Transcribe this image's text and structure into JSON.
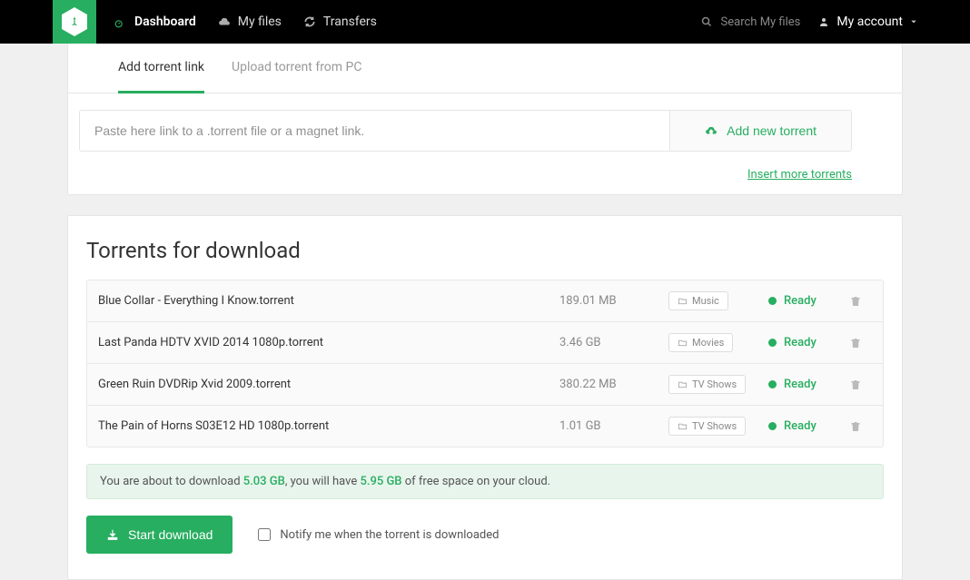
{
  "nav": {
    "dashboard": "Dashboard",
    "myfiles": "My files",
    "transfers": "Transfers",
    "search_placeholder": "Search My files",
    "account": "My account"
  },
  "tabs": {
    "add_link": "Add torrent link",
    "upload_pc": "Upload torrent from PC"
  },
  "add": {
    "placeholder": "Paste here link to a .torrent file or a magnet link.",
    "button": "Add new torrent",
    "insert_more": "Insert more torrents"
  },
  "section_title": "Torrents for download",
  "torrents": [
    {
      "name": "Blue Collar - Everything I Know.torrent",
      "size": "189.01 MB",
      "category": "Music",
      "status": "Ready"
    },
    {
      "name": "Last Panda HDTV XVID 2014 1080p.torrent",
      "size": "3.46 GB",
      "category": "Movies",
      "status": "Ready"
    },
    {
      "name": "Green Ruin DVDRip Xvid 2009.torrent",
      "size": "380.22 MB",
      "category": "TV Shows",
      "status": "Ready"
    },
    {
      "name": "The Pain of Horns S03E12 HD 1080p.torrent",
      "size": "1.01 GB",
      "category": "TV Shows",
      "status": "Ready"
    }
  ],
  "info": {
    "prefix": "You are about to download ",
    "total_size": "5.03 GB",
    "mid": ", you will have ",
    "free_space": "5.95 GB",
    "suffix": " of free space on your cloud."
  },
  "actions": {
    "start": "Start download",
    "notify": "Notify me when the torrent is downloaded"
  }
}
